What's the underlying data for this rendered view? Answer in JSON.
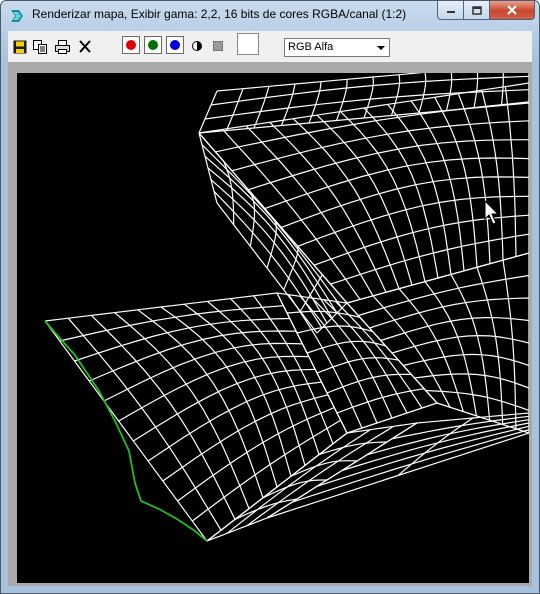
{
  "window": {
    "title": "Renderizar mapa, Exibir gama: 2,2, 16 bits de cores RGBA/canal (1:2)"
  },
  "toolbar": {
    "icons": [
      "save-icon",
      "copy-icon",
      "print-icon",
      "clear-icon"
    ],
    "channels": [
      {
        "name": "red-channel",
        "color": "#e00000"
      },
      {
        "name": "green-channel",
        "color": "#007000"
      },
      {
        "name": "blue-channel",
        "color": "#0000d8"
      }
    ],
    "channel_select": {
      "value": "RGB Alfa"
    }
  },
  "viewport": {
    "background": "#000000",
    "wire_color": "#ffffff",
    "seam_color": "#1fbf1f"
  }
}
